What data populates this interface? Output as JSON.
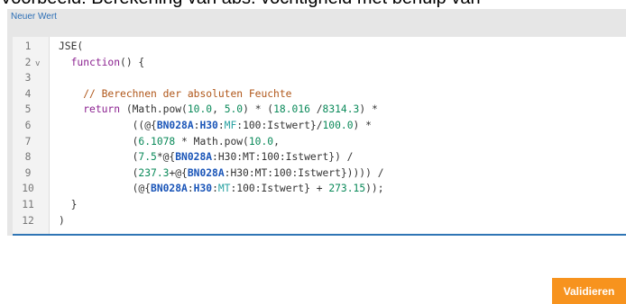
{
  "caption": "Voorbeeld: Berekening van abs. vochtigheid met behulp van",
  "field_label": "Neuer Wert",
  "editor": {
    "lines": [
      {
        "n": "1",
        "segs": [
          {
            "t": "JSE("
          }
        ]
      },
      {
        "n": "2",
        "fold": "v",
        "segs": [
          {
            "t": "  "
          },
          {
            "t": "function",
            "c": "kw"
          },
          {
            "t": "() {"
          }
        ]
      },
      {
        "n": "3",
        "segs": []
      },
      {
        "n": "4",
        "segs": [
          {
            "t": "    "
          },
          {
            "t": "// Berechnen der absoluten Feuchte",
            "c": "cm"
          }
        ]
      },
      {
        "n": "5",
        "segs": [
          {
            "t": "    "
          },
          {
            "t": "return",
            "c": "kw"
          },
          {
            "t": " (Math.pow("
          },
          {
            "t": "10.0",
            "c": "num"
          },
          {
            "t": ", "
          },
          {
            "t": "5.0",
            "c": "num"
          },
          {
            "t": ") * ("
          },
          {
            "t": "18.016",
            "c": "num"
          },
          {
            "t": " /"
          },
          {
            "t": "8314.3",
            "c": "num"
          },
          {
            "t": ") *"
          }
        ]
      },
      {
        "n": "6",
        "segs": [
          {
            "t": "            ((@{"
          },
          {
            "t": "BN028A",
            "c": "bn"
          },
          {
            "t": ":"
          },
          {
            "t": "H30",
            "c": "bn"
          },
          {
            "t": ":"
          },
          {
            "t": "MF",
            "c": "mf"
          },
          {
            "t": ":100:Istwert}/"
          },
          {
            "t": "100.0",
            "c": "num"
          },
          {
            "t": ") *"
          }
        ]
      },
      {
        "n": "7",
        "segs": [
          {
            "t": "            ("
          },
          {
            "t": "6.1078",
            "c": "num"
          },
          {
            "t": " * Math.pow("
          },
          {
            "t": "10.0",
            "c": "num"
          },
          {
            "t": ","
          }
        ]
      },
      {
        "n": "8",
        "segs": [
          {
            "t": "            ("
          },
          {
            "t": "7.5",
            "c": "num"
          },
          {
            "t": "*@{"
          },
          {
            "t": "BN028A",
            "c": "bn"
          },
          {
            "t": ":H30:MT:100:Istwert}) /"
          }
        ]
      },
      {
        "n": "9",
        "segs": [
          {
            "t": "            ("
          },
          {
            "t": "237.3",
            "c": "num"
          },
          {
            "t": "+@{"
          },
          {
            "t": "BN028A",
            "c": "bn"
          },
          {
            "t": ":H30:MT:100:Istwert})))) /"
          }
        ]
      },
      {
        "n": "10",
        "segs": [
          {
            "t": "            (@{"
          },
          {
            "t": "BN028A",
            "c": "bn"
          },
          {
            "t": ":"
          },
          {
            "t": "H30",
            "c": "bn"
          },
          {
            "t": ":"
          },
          {
            "t": "MT",
            "c": "mf"
          },
          {
            "t": ":100:Istwert} + "
          },
          {
            "t": "273.15",
            "c": "num"
          },
          {
            "t": "));"
          }
        ]
      },
      {
        "n": "11",
        "segs": [
          {
            "t": "  }"
          }
        ]
      },
      {
        "n": "12",
        "segs": [
          {
            "t": ")"
          }
        ]
      }
    ]
  },
  "buttons": {
    "validate": "Validieren"
  }
}
